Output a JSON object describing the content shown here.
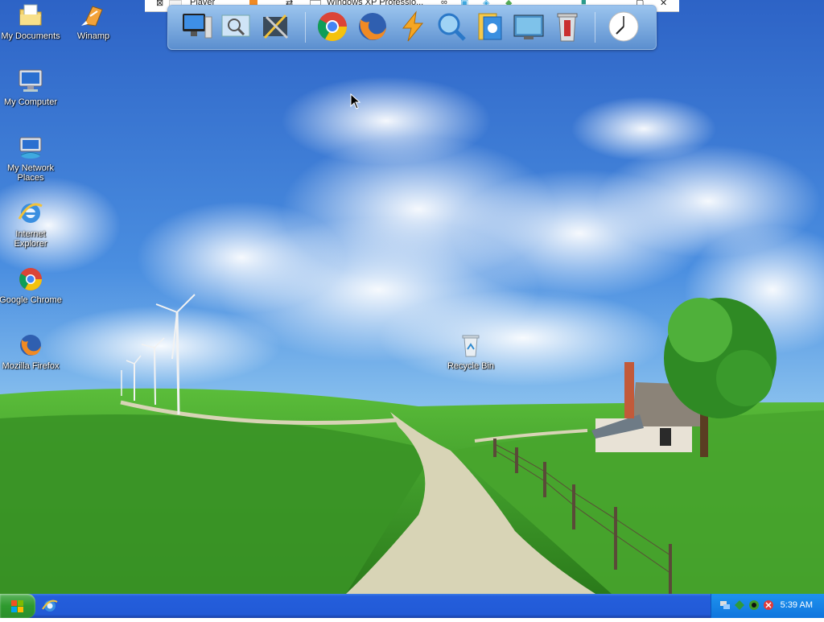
{
  "vm_toolbar": {
    "player_label": "Player",
    "tab_label": "Windows XP Professio..."
  },
  "dock": {
    "items": [
      "computer-icon",
      "magnifier-display-icon",
      "tools-icon",
      "chrome-icon",
      "firefox-icon",
      "lightning-icon",
      "search-globe-icon",
      "documents-icon",
      "monitor-icon",
      "trash-icon",
      "clock-icon"
    ]
  },
  "desktop": {
    "icons": [
      {
        "label": "My Documents",
        "icon": "folder-documents-icon"
      },
      {
        "label": "Winamp",
        "icon": "winamp-icon"
      },
      {
        "label": "My Computer",
        "icon": "computer-icon"
      },
      {
        "label": "My Network Places",
        "icon": "network-icon"
      },
      {
        "label": "Internet Explorer",
        "icon": "ie-icon"
      },
      {
        "label": "Google Chrome",
        "icon": "chrome-icon"
      },
      {
        "label": "Mozilla Firefox",
        "icon": "firefox-icon"
      },
      {
        "label": "Recycle Bin",
        "icon": "recycle-bin-icon"
      }
    ]
  },
  "taskbar": {
    "clock": "5:39 AM"
  },
  "colors": {
    "taskbar": "#245edc",
    "start": "#2e9a2e",
    "tray": "#0f75dd",
    "sky": "#3f7fd4",
    "grass": "#3f9a2a"
  }
}
